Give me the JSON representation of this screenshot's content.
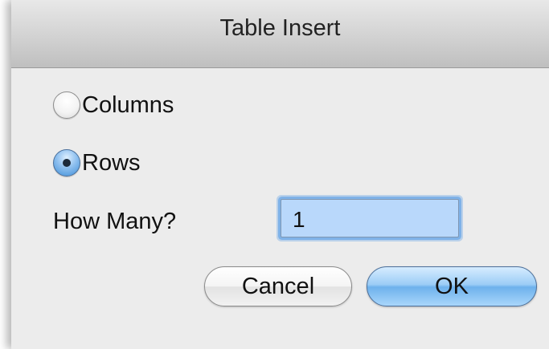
{
  "dialog": {
    "title": "Table Insert"
  },
  "options": [
    {
      "label": "Columns",
      "checked": false
    },
    {
      "label": "Rows",
      "checked": true
    }
  ],
  "count": {
    "label": "How Many?",
    "value": "1"
  },
  "buttons": {
    "cancel": "Cancel",
    "ok": "OK"
  },
  "colors": {
    "accent": "#6eb1ec",
    "input_focus": "#7fb2e8",
    "window_bg": "#ececec"
  },
  "icons": {
    "radio_unchecked": "radio-unchecked-icon",
    "radio_checked": "radio-checked-icon"
  }
}
